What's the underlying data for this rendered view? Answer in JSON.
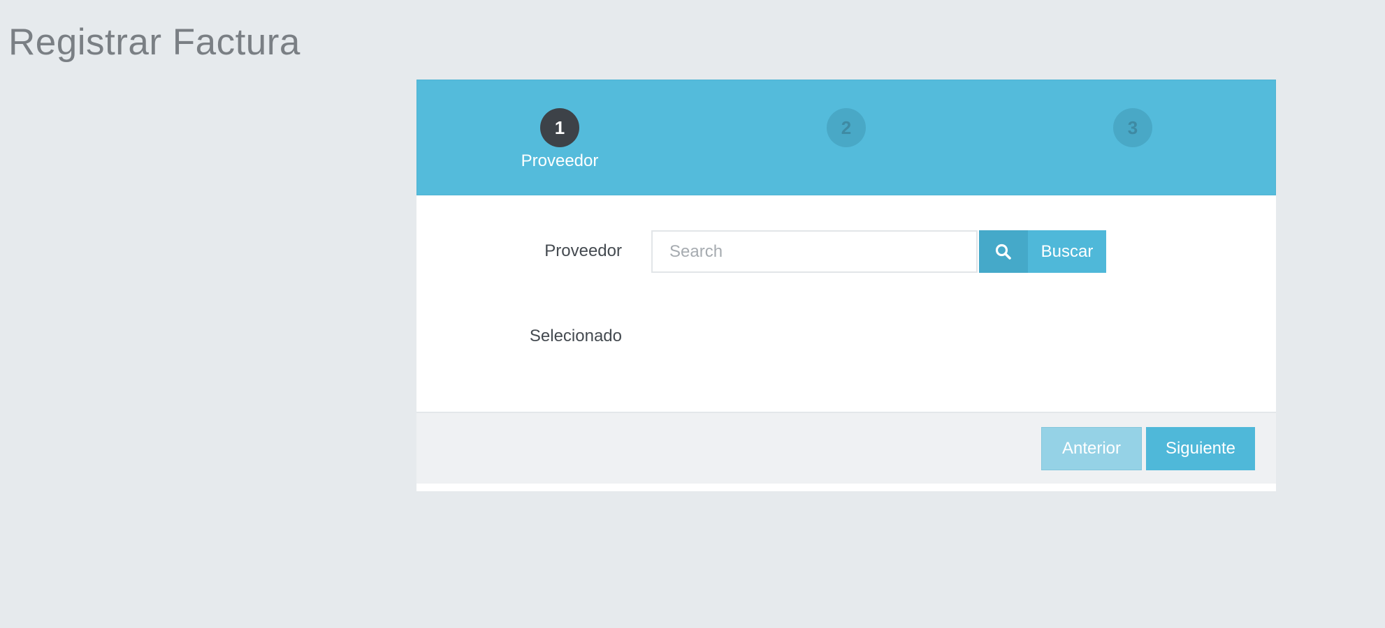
{
  "page": {
    "title": "Registrar Factura"
  },
  "wizard": {
    "steps": [
      {
        "number": "1",
        "label": "Proveedor",
        "active": true
      },
      {
        "number": "2",
        "label": "",
        "active": false
      },
      {
        "number": "3",
        "label": "",
        "active": false
      }
    ],
    "form": {
      "proveedor_label": "Proveedor",
      "search_placeholder": "Search",
      "search_value": "",
      "search_button_label": "Buscar",
      "selected_label": "Selecionado",
      "selected_value": ""
    },
    "footer": {
      "prev_label": "Anterior",
      "next_label": "Siguiente"
    }
  },
  "colors": {
    "background": "#e6eaed",
    "header": "#54bbdb",
    "accent": "#4fb8d9",
    "active_step": "#3d4248"
  },
  "icons": {
    "search": "search-icon"
  }
}
